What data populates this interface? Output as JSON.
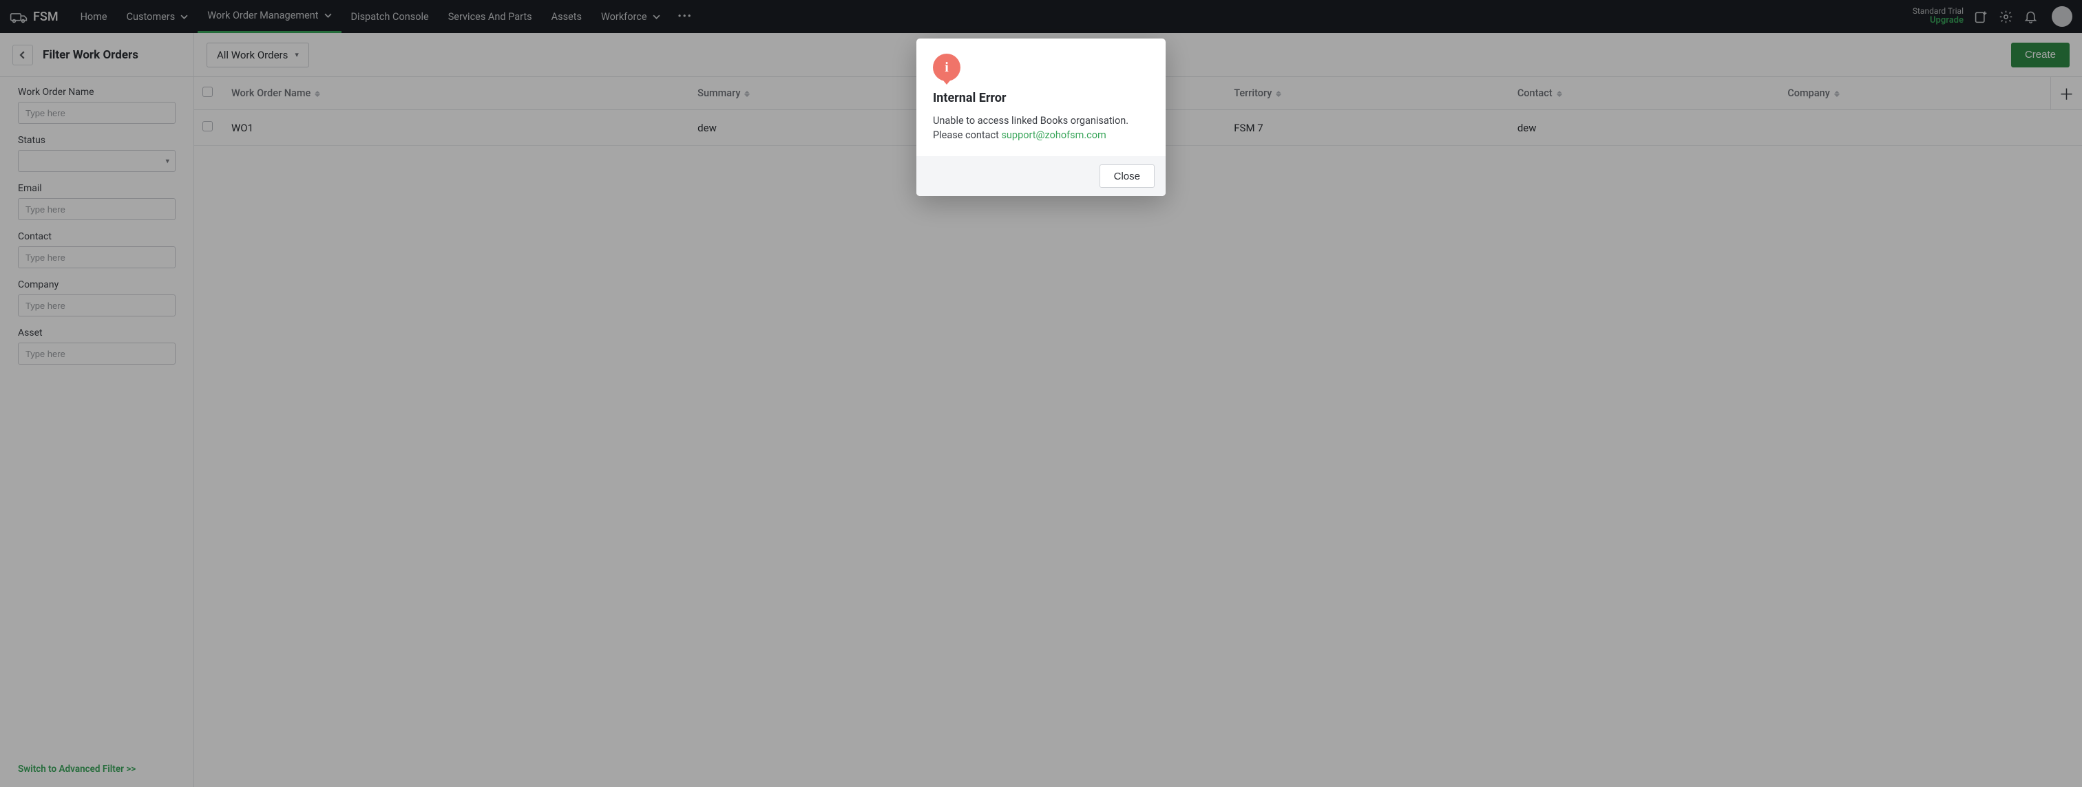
{
  "brand": {
    "name": "FSM"
  },
  "nav": {
    "items": [
      "Home",
      "Customers",
      "Work Order Management",
      "Dispatch Console",
      "Services And Parts",
      "Assets",
      "Workforce"
    ],
    "has_submenu": [
      false,
      true,
      true,
      false,
      false,
      false,
      true
    ],
    "active_index": 2,
    "trial_label": "Standard Trial",
    "upgrade_label": "Upgrade"
  },
  "sidebar": {
    "title": "Filter Work Orders",
    "filters": [
      {
        "label": "Work Order Name",
        "type": "text",
        "placeholder": "Type here"
      },
      {
        "label": "Status",
        "type": "select"
      },
      {
        "label": "Email",
        "type": "text",
        "placeholder": "Type here"
      },
      {
        "label": "Contact",
        "type": "text",
        "placeholder": "Type here"
      },
      {
        "label": "Company",
        "type": "text",
        "placeholder": "Type here"
      },
      {
        "label": "Asset",
        "type": "text",
        "placeholder": "Type here"
      }
    ],
    "advanced_link": "Switch to Advanced Filter >>"
  },
  "toolbar": {
    "view_label": "All Work Orders",
    "create_label": "Create"
  },
  "table": {
    "columns": [
      "Work Order Name",
      "Summary",
      "",
      "",
      "Territory",
      "Contact",
      "Company"
    ],
    "rows": [
      {
        "name": "WO1",
        "summary": "dew",
        "c3": "",
        "c4": "",
        "territory": "FSM 7",
        "contact": "dew",
        "company": ""
      }
    ]
  },
  "modal": {
    "title": "Internal Error",
    "message_pre": "Unable to access linked Books organisation. Please contact ",
    "support_email": "support@zohofsm.com",
    "close_label": "Close"
  }
}
